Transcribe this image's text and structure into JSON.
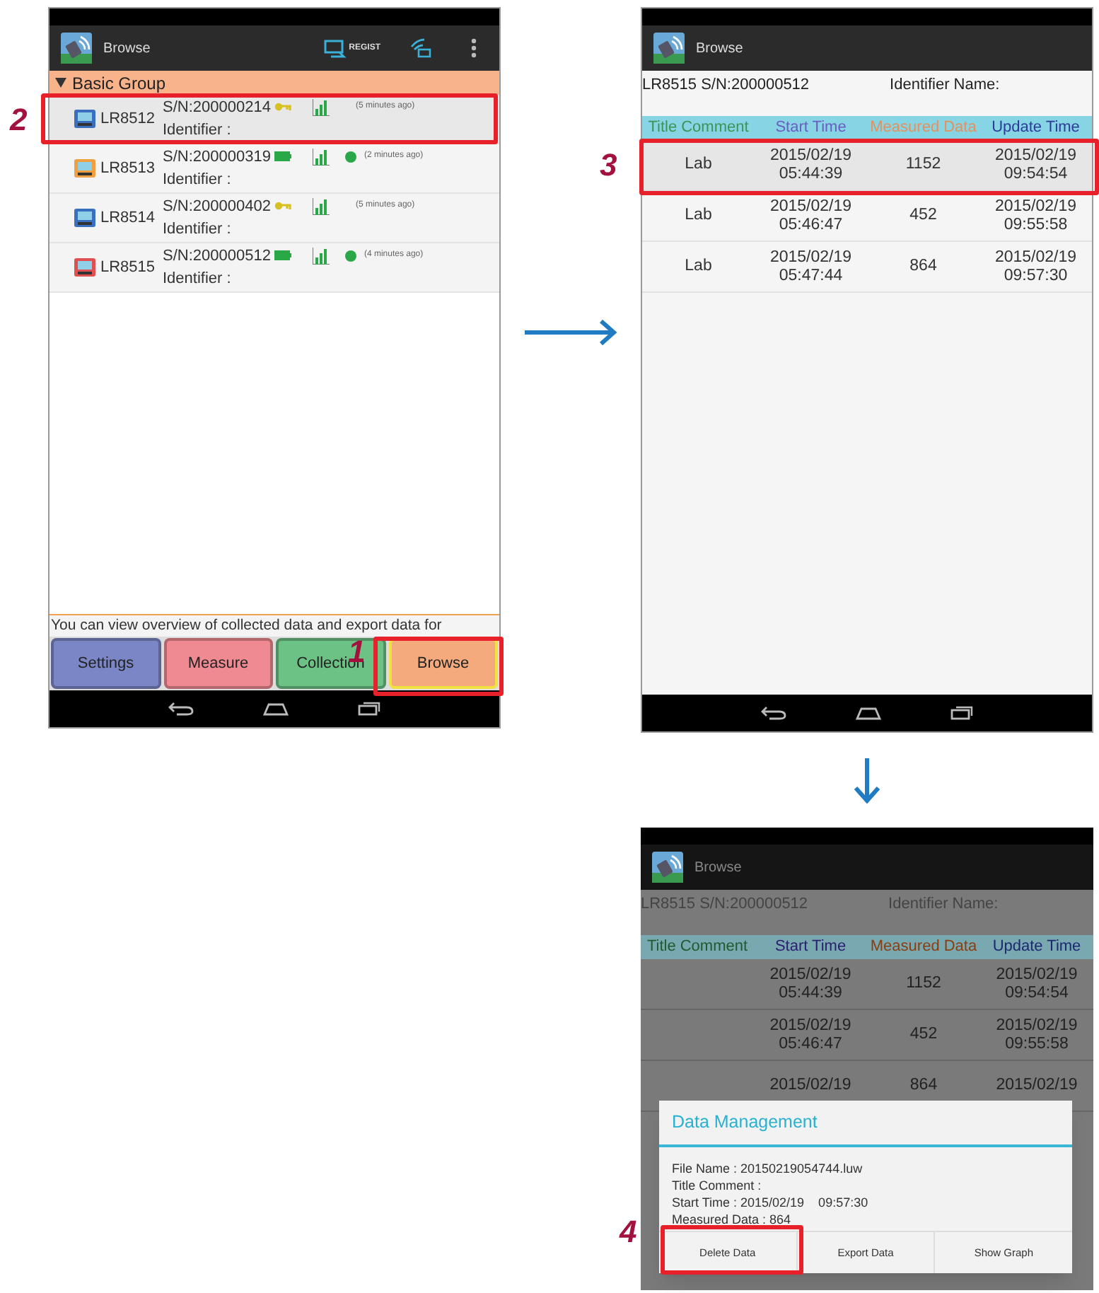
{
  "device_list_screen": {
    "title": "Browse",
    "regist_label": "REGIST",
    "group": {
      "label": "Basic Group",
      "expanded": true
    },
    "devices": [
      {
        "model": "LR8512",
        "serial": "S/N:200000214",
        "kind": "key",
        "time": "(5 minutes ago)",
        "identifier": "Identifier :",
        "color": "#3a6fc0",
        "selected": true
      },
      {
        "model": "LR8513",
        "serial": "S/N:200000319",
        "kind": "battery",
        "time": "(2 minutes ago)",
        "identifier": "Identifier :",
        "color": "#f0a040",
        "selected": false
      },
      {
        "model": "LR8514",
        "serial": "S/N:200000402",
        "kind": "key",
        "time": "(5 minutes ago)",
        "identifier": "Identifier :",
        "color": "#3a6fc0",
        "selected": false
      },
      {
        "model": "LR8515",
        "serial": "S/N:200000512",
        "kind": "battery",
        "time": "(4 minutes ago)",
        "identifier": "Identifier :",
        "color": "#e05050",
        "selected": false
      }
    ],
    "hint": "You can view overview of collected data and export data for",
    "tabs": [
      {
        "label": "Settings",
        "color": "#7b86c6",
        "selected": false
      },
      {
        "label": "Measure",
        "color": "#ef8a92",
        "selected": false
      },
      {
        "label": "Collection",
        "color": "#6cc184",
        "selected": false
      },
      {
        "label": "Browse",
        "color": "#f4aa7c",
        "selected": true
      }
    ]
  },
  "data_list_screen": {
    "title": "Browse",
    "device": "LR8515 S/N:200000512",
    "identifier_label": "Identifier Name:",
    "columns": [
      {
        "label": "Title Comment",
        "color": "#3d9455"
      },
      {
        "label": "Start Time",
        "color": "#6a5cc0"
      },
      {
        "label": "Measured Data",
        "color": "#e8905a"
      },
      {
        "label": "Update Time",
        "color": "#2c3c98"
      }
    ],
    "rows": [
      {
        "cells": [
          [
            "Lab"
          ],
          [
            "2015/02/19",
            "05:44:39"
          ],
          [
            "1152"
          ],
          [
            "2015/02/19",
            "09:54:54"
          ]
        ],
        "selected": true
      },
      {
        "cells": [
          [
            "Lab"
          ],
          [
            "2015/02/19",
            "05:46:47"
          ],
          [
            "452"
          ],
          [
            "2015/02/19",
            "09:55:58"
          ]
        ],
        "selected": false
      },
      {
        "cells": [
          [
            "Lab"
          ],
          [
            "2015/02/19",
            "05:47:44"
          ],
          [
            "864"
          ],
          [
            "2015/02/19",
            "09:57:30"
          ]
        ],
        "selected": false
      }
    ]
  },
  "dialog_screen": {
    "title": "Browse",
    "device": "LR8515 S/N:200000512",
    "identifier_label": "Identifier Name:",
    "columns": [
      {
        "label": "Title Comment",
        "color": "#1f5a2e"
      },
      {
        "label": "Start Time",
        "color": "#2a2070"
      },
      {
        "label": "Measured Data",
        "color": "#8a3e10"
      },
      {
        "label": "Update Time",
        "color": "#1c2870"
      }
    ],
    "rows": [
      {
        "cells": [
          [],
          [
            "2015/02/19",
            "05:44:39"
          ],
          [
            "1152"
          ],
          [
            "2015/02/19",
            "09:54:54"
          ]
        ]
      },
      {
        "cells": [
          [],
          [
            "2015/02/19",
            "05:46:47"
          ],
          [
            "452"
          ],
          [
            "2015/02/19",
            "09:55:58"
          ]
        ]
      },
      {
        "cells": [
          [],
          [
            "2015/02/19"
          ],
          [
            "864"
          ],
          [
            "2015/02/19"
          ]
        ]
      }
    ],
    "dialog": {
      "title": "Data Management",
      "lines": [
        "File Name : 20150219054744.luw",
        "Title Comment :",
        "Start Time : 2015/02/19    09:57:30",
        "Measured Data : 864"
      ],
      "buttons": [
        "Delete Data",
        "Export Data",
        "Show Graph"
      ]
    }
  },
  "callouts": [
    {
      "label": "1"
    },
    {
      "label": "2"
    },
    {
      "label": "3"
    },
    {
      "label": "4"
    }
  ]
}
